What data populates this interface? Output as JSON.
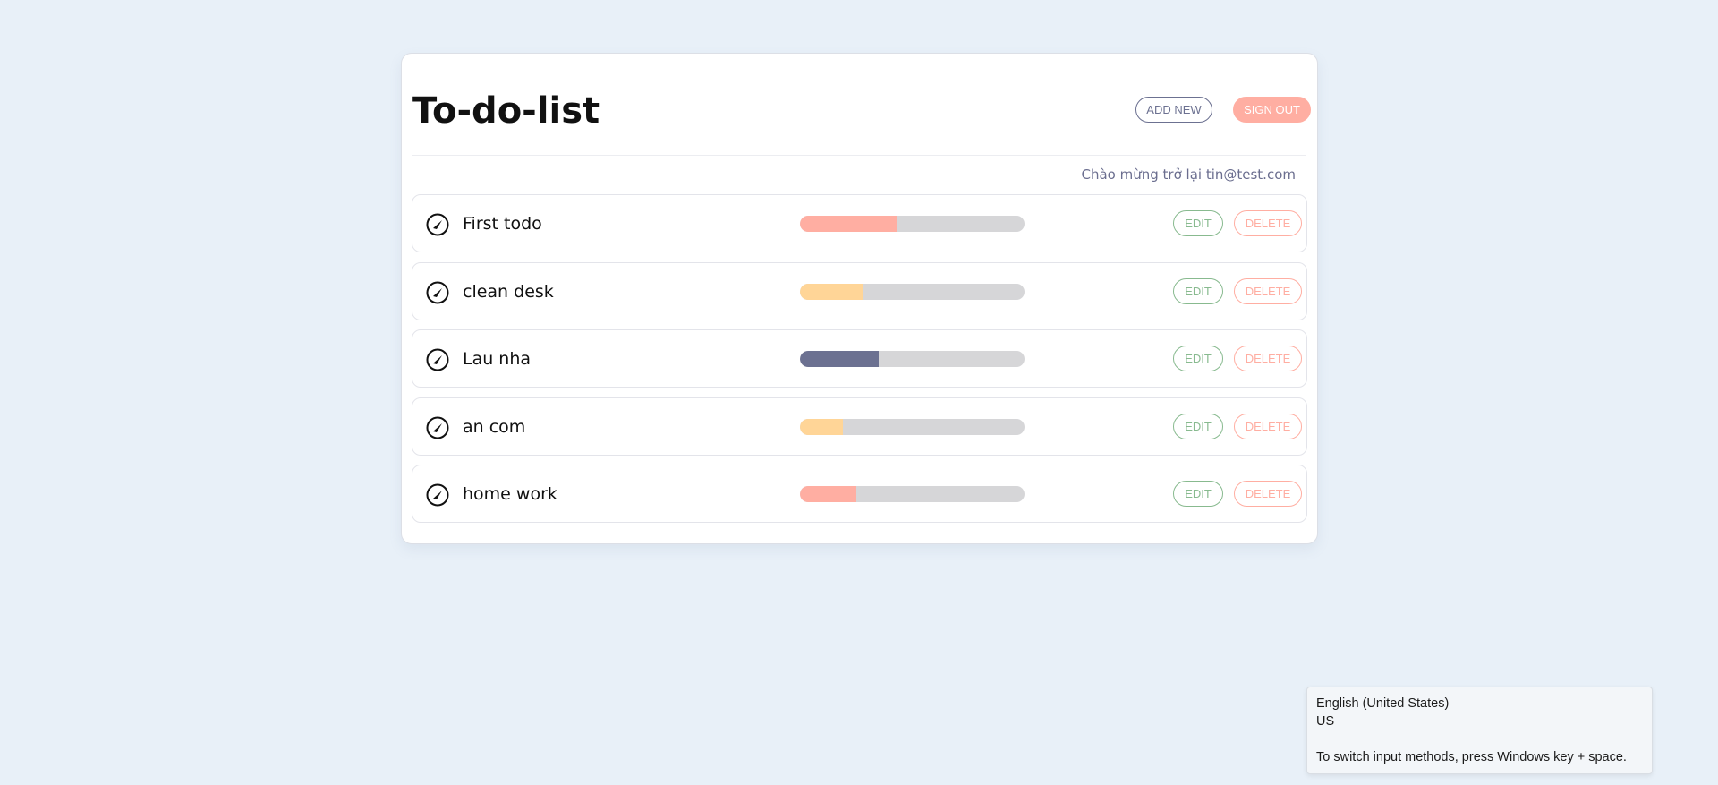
{
  "app": {
    "title": "To-do-list",
    "add_new_label": "ADD NEW",
    "sign_out_label": "SIGN OUT",
    "welcome_text": "Chào mừng trở lại tin@test.com"
  },
  "colors": {
    "accent_red": "#ffaea2",
    "accent_orange": "#ffd597",
    "accent_slate": "#6c7191",
    "edit_green": "#88ba8f",
    "track_gray": "#d6d6d8"
  },
  "todos": [
    {
      "label": "First todo",
      "progress": 0.43,
      "color": "#ffaea2",
      "edit_label": "EDIT",
      "delete_label": "DELETE"
    },
    {
      "label": "clean desk",
      "progress": 0.28,
      "color": "#ffd597",
      "edit_label": "EDIT",
      "delete_label": "DELETE"
    },
    {
      "label": "Lau nha",
      "progress": 0.35,
      "color": "#6c7191",
      "edit_label": "EDIT",
      "delete_label": "DELETE"
    },
    {
      "label": "an com",
      "progress": 0.19,
      "color": "#ffd597",
      "edit_label": "EDIT",
      "delete_label": "DELETE"
    },
    {
      "label": "home work",
      "progress": 0.25,
      "color": "#ffaea2",
      "edit_label": "EDIT",
      "delete_label": "DELETE"
    }
  ],
  "tooltip": {
    "language": "English (United States)",
    "layout": "US",
    "hint": "To switch input methods, press Windows key + space."
  }
}
